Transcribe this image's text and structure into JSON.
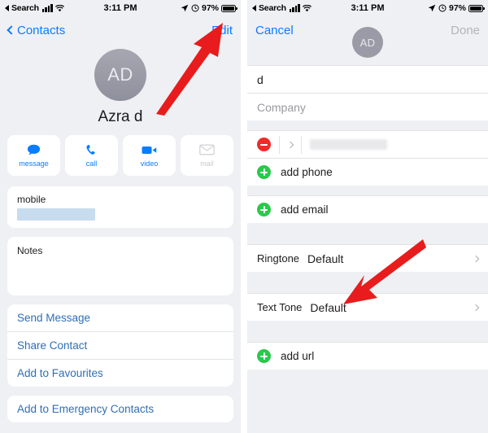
{
  "status_bar": {
    "carrier_back_label": "Search",
    "time": "3:11 PM",
    "battery_percent": "97%",
    "icons": [
      "back-triangle-icon",
      "signal-bars-icon",
      "wifi-icon",
      "location-arrow-icon",
      "alarm-icon",
      "battery-icon"
    ]
  },
  "left_panel": {
    "nav": {
      "back_label": "Contacts",
      "edit_label": "Edit"
    },
    "contact": {
      "initials": "AD",
      "name": "Azra d"
    },
    "actions": [
      {
        "label": "message",
        "icon": "message-bubble-icon",
        "enabled": true
      },
      {
        "label": "call",
        "icon": "phone-handset-icon",
        "enabled": true
      },
      {
        "label": "video",
        "icon": "video-camera-icon",
        "enabled": true
      },
      {
        "label": "mail",
        "icon": "envelope-icon",
        "enabled": false
      }
    ],
    "phone_card": {
      "label": "mobile",
      "value_redacted": true
    },
    "notes_card": {
      "label": "Notes",
      "value": ""
    },
    "links": [
      "Send Message",
      "Share Contact",
      "Add to Favourites"
    ],
    "emergency_link": "Add to Emergency Contacts"
  },
  "right_panel": {
    "nav": {
      "cancel_label": "Cancel",
      "initials": "AD",
      "done_label": "Done",
      "done_enabled": false
    },
    "fields": {
      "last_name": "d",
      "company_placeholder": "Company"
    },
    "phone_row": {
      "delete_icon": "minus-circle-icon",
      "disclosure_icon": "chevron-right-icon",
      "value_blurred": true
    },
    "add_phone_label": "add phone",
    "add_email_label": "add email",
    "ringtone": {
      "label": "Ringtone",
      "value": "Default"
    },
    "text_tone": {
      "label": "Text Tone",
      "value": "Default"
    },
    "add_url_label": "add url"
  },
  "annotations": {
    "arrow_color": "#e81c1c",
    "left_arrow_target": "Edit",
    "right_arrow_target": "Default"
  },
  "colors": {
    "accent_blue": "#0a7cff",
    "link_blue": "#2f6fb5",
    "background": "#eff0f4",
    "card": "#ffffff",
    "red": "#f02a28",
    "green": "#2bc84a",
    "disabled": "#b4b4ba"
  }
}
